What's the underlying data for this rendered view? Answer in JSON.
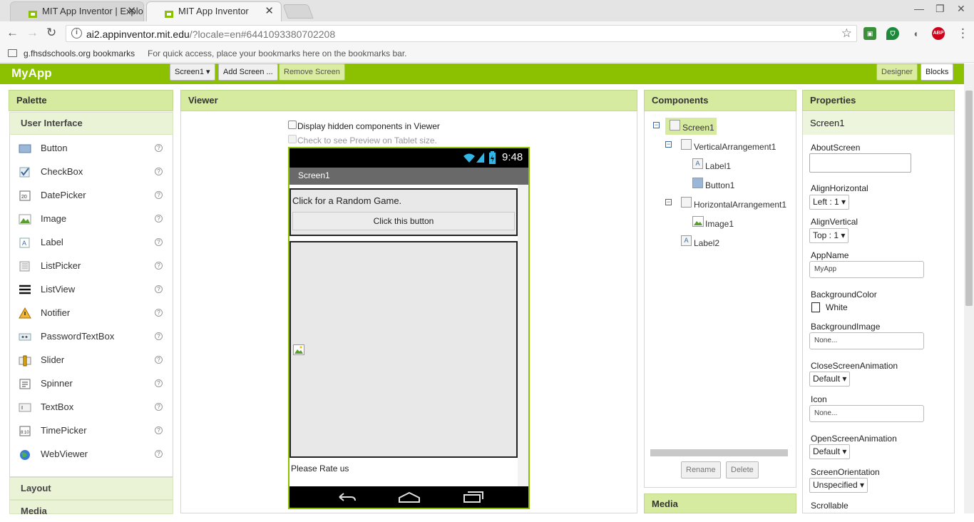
{
  "browser": {
    "tabs": [
      {
        "title": "MIT App Inventor | Explo"
      },
      {
        "title": "MIT App Inventor"
      }
    ],
    "url_host": "ai2.appinventor.mit.edu",
    "url_path": "/?locale=en#6441093380702208",
    "bookmarks_folder": "g.fhsdschools.org bookmarks",
    "bookmarks_hint": "For quick access, place your bookmarks here on the bookmarks bar.",
    "ext_abp": "ABP"
  },
  "app": {
    "name": "MyApp",
    "screen_select": "Screen1 ▾",
    "add_screen": "Add Screen ...",
    "remove_screen": "Remove Screen",
    "designer": "Designer",
    "blocks": "Blocks"
  },
  "palette": {
    "title": "Palette",
    "section": "User Interface",
    "items": [
      {
        "label": "Button",
        "icon": "button-icon"
      },
      {
        "label": "CheckBox",
        "icon": "checkbox-icon"
      },
      {
        "label": "DatePicker",
        "icon": "datepicker-icon"
      },
      {
        "label": "Image",
        "icon": "image-icon"
      },
      {
        "label": "Label",
        "icon": "label-icon"
      },
      {
        "label": "ListPicker",
        "icon": "listpicker-icon"
      },
      {
        "label": "ListView",
        "icon": "listview-icon"
      },
      {
        "label": "Notifier",
        "icon": "notifier-icon"
      },
      {
        "label": "PasswordTextBox",
        "icon": "passwordtextbox-icon"
      },
      {
        "label": "Slider",
        "icon": "slider-icon"
      },
      {
        "label": "Spinner",
        "icon": "spinner-icon"
      },
      {
        "label": "TextBox",
        "icon": "textbox-icon"
      },
      {
        "label": "TimePicker",
        "icon": "timepicker-icon"
      },
      {
        "label": "WebViewer",
        "icon": "webviewer-icon"
      }
    ],
    "help_glyph": "?",
    "layout_section": "Layout",
    "media_section": "Media"
  },
  "viewer": {
    "title": "Viewer",
    "show_hidden": "Display hidden components in Viewer",
    "tablet_preview": "Check to see Preview on Tablet size.",
    "phone": {
      "time": "9:48",
      "screen_title": "Screen1",
      "label1": "Click for a Random Game.",
      "button1": "Click this button",
      "label2": "Please Rate us"
    }
  },
  "components": {
    "title": "Components",
    "tree": {
      "screen": "Screen1",
      "vertical": "VerticalArrangement1",
      "label1": "Label1",
      "button1": "Button1",
      "horizontal": "HorizontalArrangement1",
      "image1": "Image1",
      "label2": "Label2"
    },
    "rename": "Rename",
    "delete": "Delete",
    "media": "Media"
  },
  "properties": {
    "title": "Properties",
    "component": "Screen1",
    "about_screen": "AboutScreen",
    "align_horizontal": "AlignHorizontal",
    "align_horizontal_value": "Left : 1 ▾",
    "align_vertical": "AlignVertical",
    "align_vertical_value": "Top : 1 ▾",
    "app_name": "AppName",
    "app_name_value": "MyApp",
    "background_color": "BackgroundColor",
    "background_color_value": "White",
    "background_image": "BackgroundImage",
    "background_image_value": "None...",
    "close_anim": "CloseScreenAnimation",
    "close_anim_value": "Default ▾",
    "icon": "Icon",
    "icon_value": "None...",
    "open_anim": "OpenScreenAnimation",
    "open_anim_value": "Default ▾",
    "orientation": "ScreenOrientation",
    "orientation_value": "Unspecified ▾",
    "scrollable": "Scrollable"
  },
  "colors": {
    "accent": "#8cc101",
    "panel_header": "#d6eba0"
  }
}
